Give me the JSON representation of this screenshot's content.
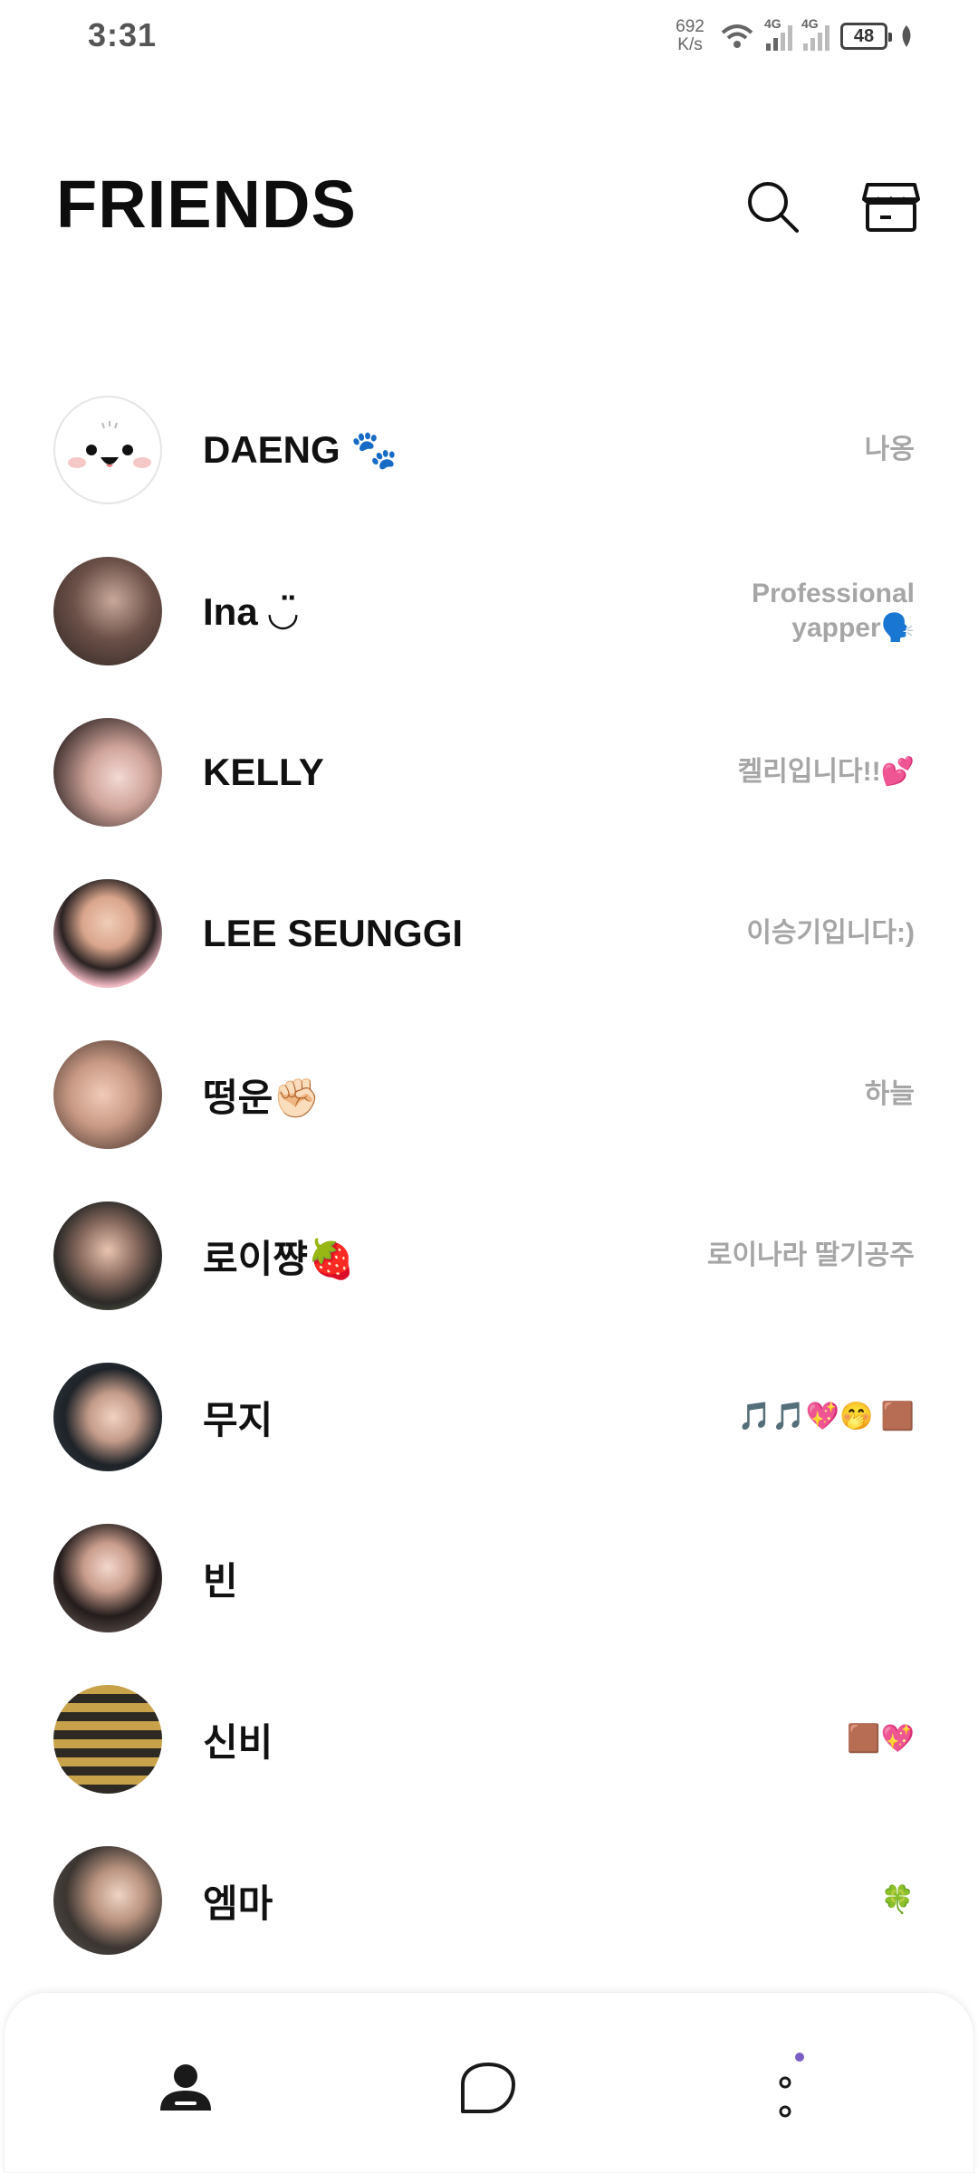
{
  "status_bar": {
    "time": "3:31",
    "net_speed_value": "692",
    "net_speed_unit": "K/s",
    "network_1": "4G",
    "network_2": "4G",
    "battery": "48"
  },
  "header": {
    "title": "FRIENDS",
    "search_icon": "search-icon",
    "shop_icon": "shop-icon"
  },
  "friends": [
    {
      "name": "DAENG 🐾",
      "status": "나옹"
    },
    {
      "name": "Ina ◡̈",
      "status": "Professional\nyapper🗣️"
    },
    {
      "name": "KELLY",
      "status": "켈리입니다!!💕"
    },
    {
      "name": "LEE SEUNGGI",
      "status": "이승기입니다:)"
    },
    {
      "name": "떵운✊🏻",
      "status": "하늘    "
    },
    {
      "name": "로이쨩🍓",
      "status": "로이나라 딸기공주"
    },
    {
      "name": "무지",
      "status": "🎵🎵💖🤭  🟫"
    },
    {
      "name": "빈",
      "status": ""
    },
    {
      "name": "신비",
      "status": "🟫💖"
    },
    {
      "name": "엠마",
      "status": "🍀"
    }
  ],
  "colors": {
    "accent_dot": "#7b5fc7",
    "status_text": "#a6a6a6"
  },
  "nav": {
    "friends_icon": "person-icon",
    "chats_icon": "chat-bubble-icon",
    "more_icon": "more-dots-icon"
  }
}
